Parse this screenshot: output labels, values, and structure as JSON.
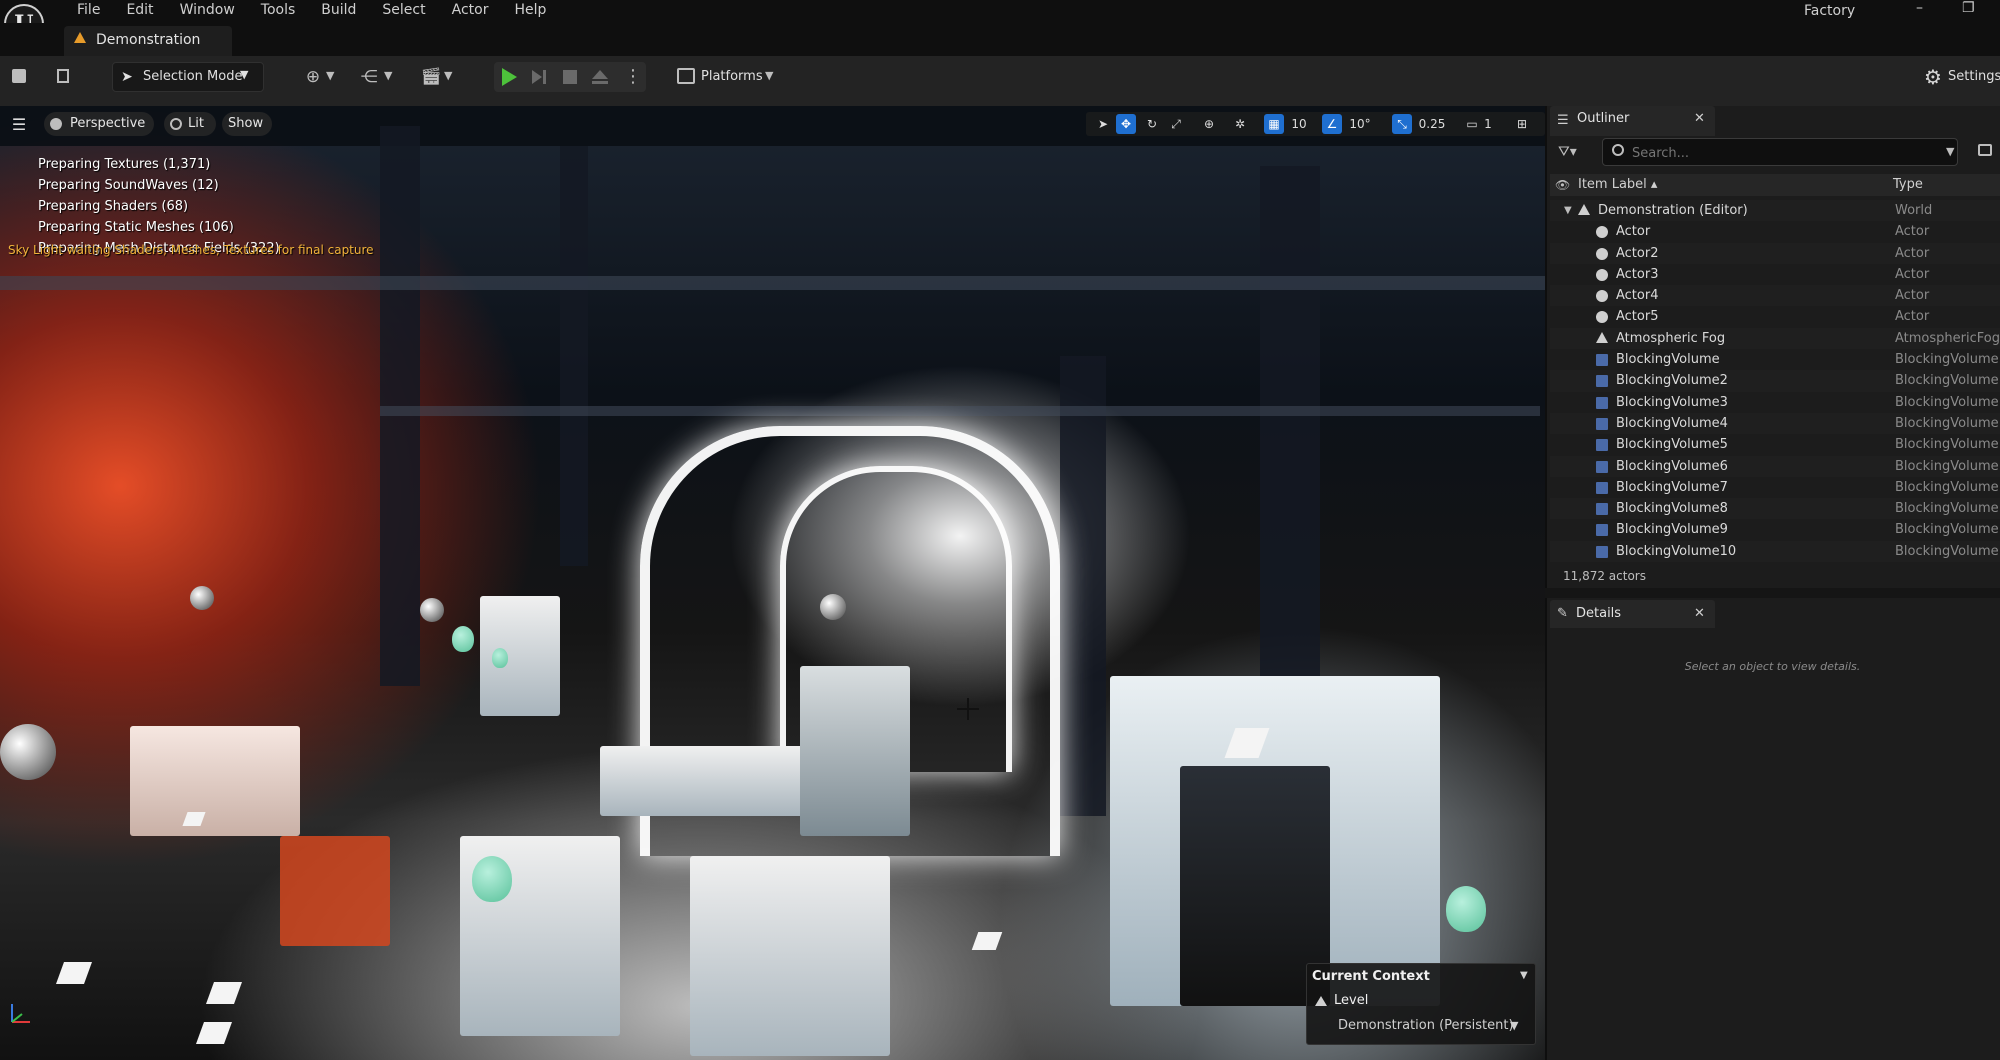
{
  "app": {
    "logo_text": "U",
    "project_name": "Factory",
    "minimize": "–",
    "restore": "❐"
  },
  "menu": [
    "File",
    "Edit",
    "Window",
    "Tools",
    "Build",
    "Select",
    "Actor",
    "Help"
  ],
  "document_tab": {
    "label": "Demonstration",
    "icon": "level-icon"
  },
  "toolbar": {
    "selection_mode": "Selection Mode",
    "platforms": "Platforms",
    "settings": "Settings",
    "play_color": "#4dc23b"
  },
  "viewport": {
    "perspective": "Perspective",
    "lit": "Lit",
    "show": "Show",
    "grid_snap": "10",
    "rotation_snap": "10°",
    "scale_snap": "0.25",
    "camera_speed": "1",
    "compile_status": [
      "Preparing Textures (1,371)",
      "Preparing SoundWaves (12)",
      "Preparing Shaders (68)",
      "Preparing Static Meshes (106)",
      "Preparing Mesh Distance Fields (322)"
    ],
    "warning": "Sky Light waiting Shaders, Meshes, Textures for final capture",
    "current_context": {
      "title": "Current Context",
      "level_label": "Level",
      "level_value": "Demonstration (Persistent)"
    }
  },
  "outliner": {
    "tab_label": "Outliner",
    "search_placeholder": "Search...",
    "col_label": "Item Label ▴",
    "col_type": "Type",
    "rows": [
      {
        "label": "Demonstration (Editor)",
        "type": "World",
        "icon": "world"
      },
      {
        "label": "Actor",
        "type": "Actor",
        "icon": "actor"
      },
      {
        "label": "Actor2",
        "type": "Actor",
        "icon": "actor"
      },
      {
        "label": "Actor3",
        "type": "Actor",
        "icon": "actor"
      },
      {
        "label": "Actor4",
        "type": "Actor",
        "icon": "actor"
      },
      {
        "label": "Actor5",
        "type": "Actor",
        "icon": "actor"
      },
      {
        "label": "Atmospheric Fog",
        "type": "AtmosphericFog",
        "icon": "fog"
      },
      {
        "label": "BlockingVolume",
        "type": "BlockingVolume",
        "icon": "bv"
      },
      {
        "label": "BlockingVolume2",
        "type": "BlockingVolume",
        "icon": "bv"
      },
      {
        "label": "BlockingVolume3",
        "type": "BlockingVolume",
        "icon": "bv"
      },
      {
        "label": "BlockingVolume4",
        "type": "BlockingVolume",
        "icon": "bv"
      },
      {
        "label": "BlockingVolume5",
        "type": "BlockingVolume",
        "icon": "bv"
      },
      {
        "label": "BlockingVolume6",
        "type": "BlockingVolume",
        "icon": "bv"
      },
      {
        "label": "BlockingVolume7",
        "type": "BlockingVolume",
        "icon": "bv"
      },
      {
        "label": "BlockingVolume8",
        "type": "BlockingVolume",
        "icon": "bv"
      },
      {
        "label": "BlockingVolume9",
        "type": "BlockingVolume",
        "icon": "bv"
      },
      {
        "label": "BlockingVolume10",
        "type": "BlockingVolume",
        "icon": "bv"
      }
    ],
    "count": "11,872 actors"
  },
  "details": {
    "tab_label": "Details",
    "empty_text": "Select an object to view details."
  }
}
